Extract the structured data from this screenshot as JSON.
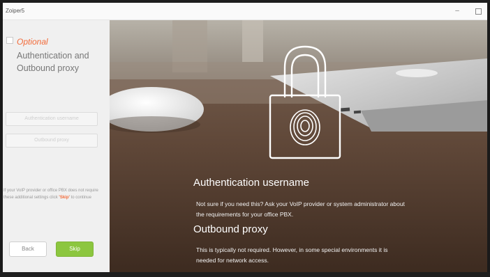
{
  "window": {
    "title": "Zoiper5",
    "minimize_glyph": "–"
  },
  "sidebar": {
    "optional_label": "Optional",
    "heading": "Authentication and Outbound proxy",
    "auth_button_label": "Authentication username",
    "proxy_button_label": "Outbound proxy",
    "help_prefix": "If your VoIP provider or office PBX does not require these additional settings click ",
    "help_skip_word": "'Skip'",
    "help_suffix": " to continue",
    "back_label": "Back",
    "skip_label": "Skip"
  },
  "hero": {
    "title_auth": "Authentication username",
    "body_auth": "Not sure if you need this? Ask your VoIP provider or system administrator about the requirements for your office PBX.",
    "title_proxy": "Outbound proxy",
    "body_proxy": "This is typically not required. However, in some special environments it is needed for network access.",
    "icon": "lock-fingerprint-icon"
  },
  "colors": {
    "accent_orange": "#f26b3a",
    "skip_green": "#8cc63f"
  }
}
